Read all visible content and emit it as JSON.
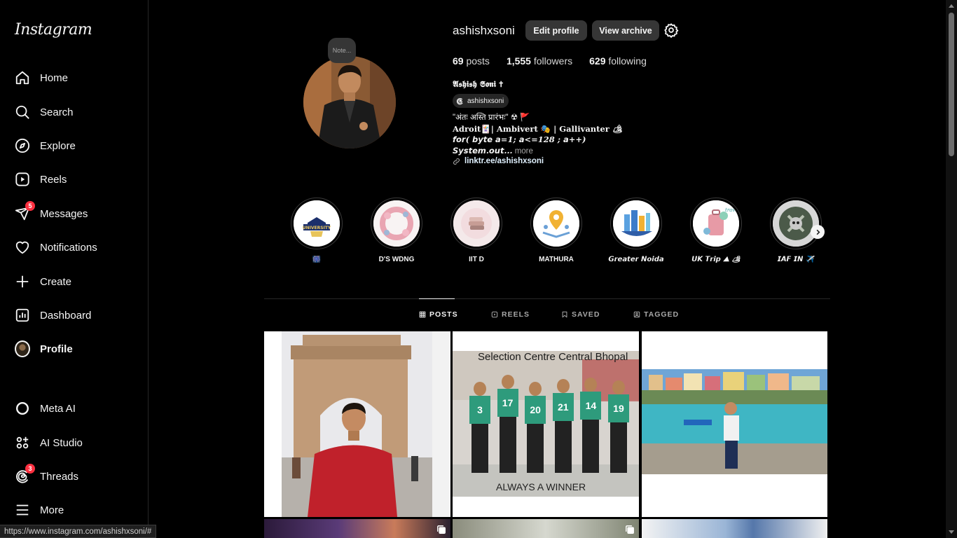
{
  "app": {
    "logo_text": "Instagram"
  },
  "sidebar": {
    "items": [
      {
        "label": "Home",
        "icon": "home-icon"
      },
      {
        "label": "Search",
        "icon": "search-icon"
      },
      {
        "label": "Explore",
        "icon": "compass-icon"
      },
      {
        "label": "Reels",
        "icon": "reels-icon"
      },
      {
        "label": "Messages",
        "icon": "messenger-icon",
        "badge": "5"
      },
      {
        "label": "Notifications",
        "icon": "heart-icon"
      },
      {
        "label": "Create",
        "icon": "plus-icon"
      },
      {
        "label": "Dashboard",
        "icon": "dashboard-icon"
      },
      {
        "label": "Profile",
        "icon": "avatar"
      },
      {
        "label": "Meta AI",
        "icon": "meta-ai-icon"
      },
      {
        "label": "AI Studio",
        "icon": "ai-studio-icon"
      },
      {
        "label": "Threads",
        "icon": "threads-icon",
        "badge": "3"
      },
      {
        "label": "More",
        "icon": "hamburger-icon"
      }
    ]
  },
  "profile": {
    "note": "Note...",
    "username": "ashishxsoni",
    "edit_label": "Edit profile",
    "archive_label": "View archive",
    "posts_count": "69",
    "posts_label": " posts",
    "followers_count": "1,555",
    "followers_label": " followers",
    "following_count": "629",
    "following_label": " following",
    "full_name": "𝕬𝖘𝖍𝖎𝖘𝖍 𝕾𝖔𝖓𝖎 ✝",
    "threads_handle": "ashishxsoni",
    "bio_line1": "\"अंतः अस्ति प्रारंभः\" ☢ 🚩",
    "bio_line2": "Adroit🃏| Ambivert 🎭 | Gallivanter 🏕",
    "bio_line3": "𝙛𝙤𝙧( 𝙗𝙮𝙩𝙚 𝙖=1; 𝙖<=128 ; 𝙖++)",
    "bio_line4": "𝙎𝙮𝙨𝙩𝙚𝙢.𝙤𝙪𝙩...",
    "bio_more": " more",
    "link": "linktr.ee/ashishxsoni"
  },
  "highlights": [
    {
      "label": "🎆"
    },
    {
      "label": "D'S WDNG"
    },
    {
      "label": "IIT D"
    },
    {
      "label": "MATHURA"
    },
    {
      "label": "𝙂𝙧𝙚𝙖𝙩𝙚𝙧 𝙉𝙤𝙞𝙙𝙖"
    },
    {
      "label": "𝙐𝙆 𝙏𝙧𝙞𝙥 ⛰ 🏕"
    },
    {
      "label": "𝙄𝘼𝙁 𝙄𝙉 ✈️"
    }
  ],
  "tabs": [
    {
      "label": "POSTS",
      "icon": "grid-icon"
    },
    {
      "label": "REELS",
      "icon": "reels-icon"
    },
    {
      "label": "SAVED",
      "icon": "bookmark-icon"
    },
    {
      "label": "TAGGED",
      "icon": "tagged-icon"
    }
  ],
  "posts": [
    {
      "caption": ""
    },
    {
      "top_text": "Selection Centre Central Bhopal",
      "bottom_text": "ALWAYS A WINNER",
      "numbers": [
        "3",
        "17",
        "20",
        "21",
        "14",
        "19"
      ]
    },
    {
      "caption": ""
    }
  ],
  "status_url": "https://www.instagram.com/ashishxsoni/#"
}
